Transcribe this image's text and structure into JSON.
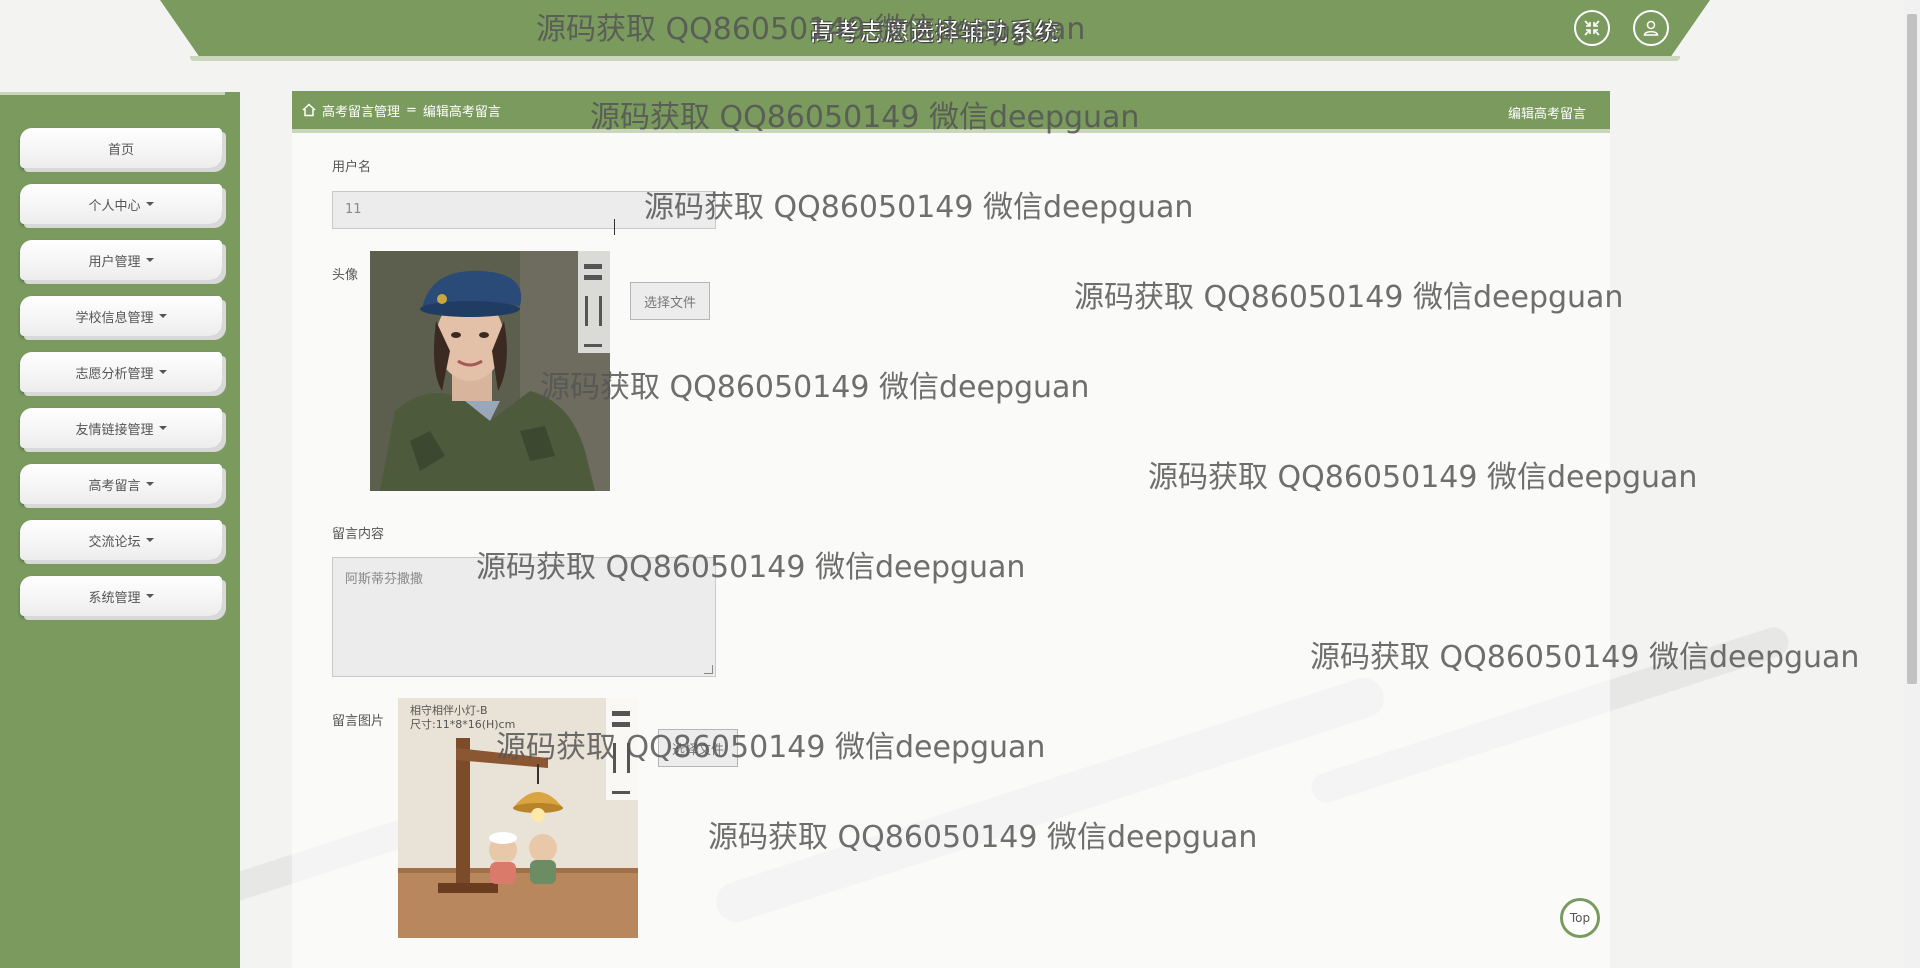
{
  "header": {
    "title": "高考志愿选择辅助系统",
    "buttons": [
      {
        "icon": "fullscreen-exit-icon"
      },
      {
        "icon": "user-icon"
      }
    ]
  },
  "sidebar": {
    "items": [
      {
        "label": "首页",
        "dropdown": false
      },
      {
        "label": "个人中心",
        "dropdown": true
      },
      {
        "label": "用户管理",
        "dropdown": true
      },
      {
        "label": "学校信息管理",
        "dropdown": true
      },
      {
        "label": "志愿分析管理",
        "dropdown": true
      },
      {
        "label": "友情链接管理",
        "dropdown": true
      },
      {
        "label": "高考留言",
        "dropdown": true
      },
      {
        "label": "交流论坛",
        "dropdown": true
      },
      {
        "label": "系统管理",
        "dropdown": true
      }
    ]
  },
  "breadcrumb": {
    "home_icon": "home-icon",
    "parent": "高考留言管理",
    "separator": "=",
    "current": "编辑高考留言"
  },
  "panel_right_title": "编辑高考留言",
  "form": {
    "username": {
      "label": "用户名",
      "value": "11"
    },
    "avatar": {
      "label": "头像",
      "file_button": "选择文件"
    },
    "content": {
      "label": "留言内容",
      "value": "阿斯蒂芬撒撒"
    },
    "message_image": {
      "label": "留言图片",
      "file_button": "选择文件",
      "image_caption_line1": "相守相伴小灯-B",
      "image_caption_line2": "尺寸:11*8*16(H)cm"
    }
  },
  "top_button": "Top",
  "watermark_text": "源码获取 QQ86050149 微信deepguan",
  "colors": {
    "primary_green": "#7a9a5e",
    "light_green": "#c9d6bc",
    "page_bg": "#f3f3f2"
  }
}
